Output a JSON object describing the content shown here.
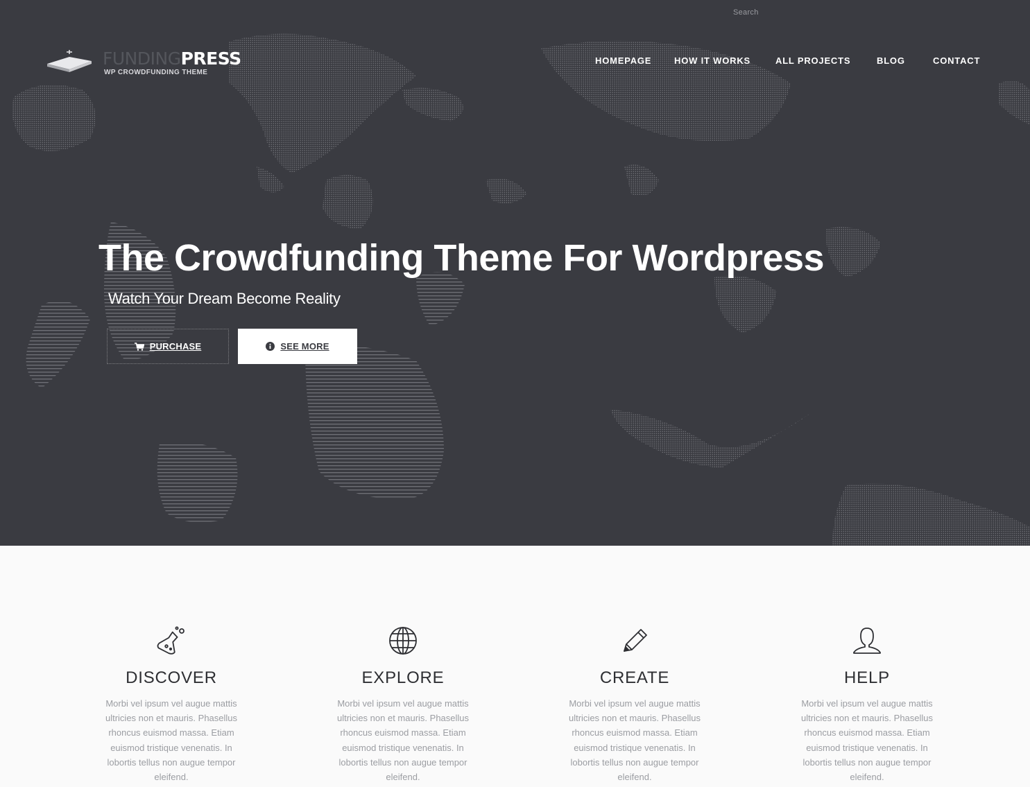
{
  "header": {
    "search_label": "Search",
    "logo": {
      "name_light": "FUNDING",
      "name_bold": "PRESS",
      "tagline": "WP CROWDFUNDING THEME"
    },
    "nav": [
      {
        "label": "HOMEPAGE"
      },
      {
        "label": "HOW IT WORKS"
      },
      {
        "label": "ALL PROJECTS"
      },
      {
        "label": "BLOG"
      },
      {
        "label": "CONTACT"
      }
    ]
  },
  "hero": {
    "title": "The Crowdfunding Theme For Wordpress",
    "subtitle": "Watch Your Dream Become Reality",
    "buttons": {
      "purchase": {
        "label": "PURCHASE",
        "icon": "cart-icon"
      },
      "see_more": {
        "label": "SEE MORE",
        "icon": "info-circle-icon"
      }
    }
  },
  "features": [
    {
      "icon": "flask-icon",
      "title": "DISCOVER",
      "text": "Morbi vel ipsum vel augue mattis ultricies non et mauris. Phasellus rhoncus euismod massa. Etiam euismod tristique venenatis. In lobortis tellus non augue tempor eleifend."
    },
    {
      "icon": "globe-icon",
      "title": "EXPLORE",
      "text": "Morbi vel ipsum vel augue mattis ultricies non et mauris. Phasellus rhoncus euismod massa. Etiam euismod tristique venenatis. In lobortis tellus non augue tempor eleifend."
    },
    {
      "icon": "pencil-icon",
      "title": "CREATE",
      "text": "Morbi vel ipsum vel augue mattis ultricies non et mauris. Phasellus rhoncus euismod massa. Etiam euismod tristique venenatis. In lobortis tellus non augue tempor eleifend."
    },
    {
      "icon": "user-icon",
      "title": "HELP",
      "text": "Morbi vel ipsum vel augue mattis ultricies non et mauris. Phasellus rhoncus euismod massa. Etiam euismod tristique venenatis. In lobortis tellus non augue tempor eleifend."
    }
  ],
  "colors": {
    "hero_background": "#3a3b41",
    "section_background": "#fafafa",
    "heading_text": "#2e2f33",
    "body_text": "#9b9da2",
    "button_light": "#ffffff"
  }
}
